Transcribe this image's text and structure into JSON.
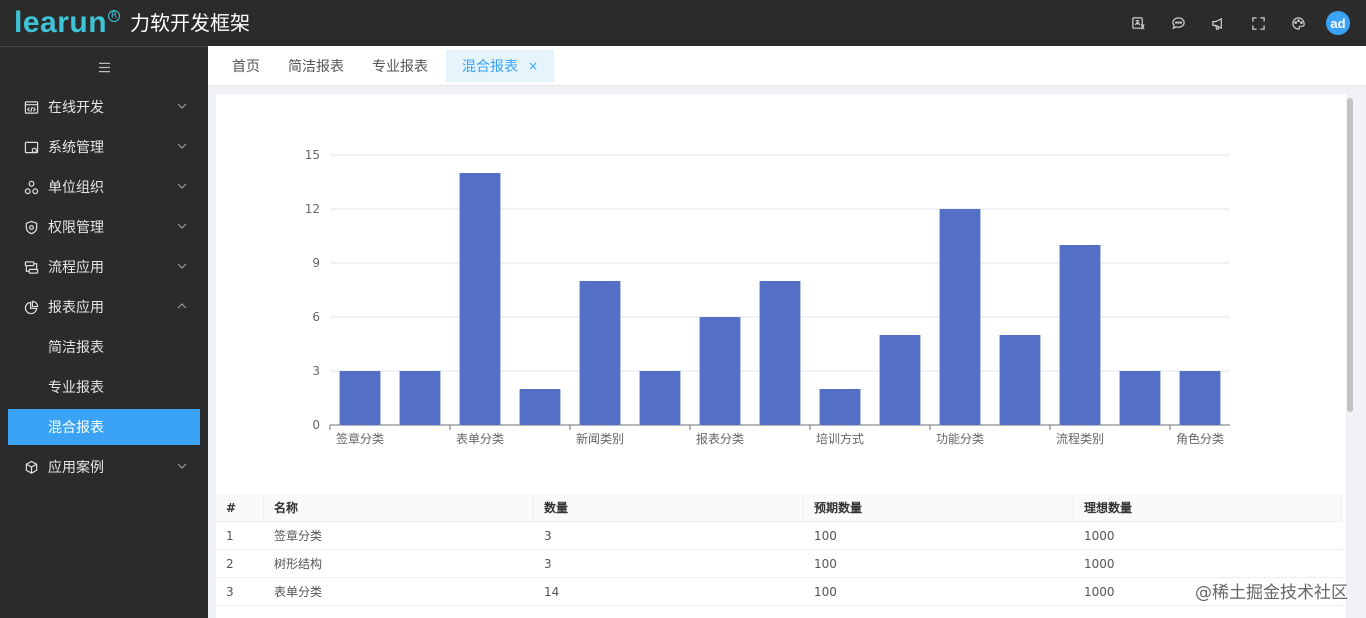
{
  "brand": {
    "logo_word": "learun",
    "logo_mark": "R",
    "title": "力软开发框架"
  },
  "header": {
    "icons": [
      "translate-icon",
      "message-icon",
      "notification-icon",
      "fullscreen-icon",
      "palette-icon"
    ],
    "avatar_text": "ad"
  },
  "sidebar": {
    "items": [
      {
        "label": "在线开发",
        "icon": "code-window-icon",
        "expanded": false
      },
      {
        "label": "系统管理",
        "icon": "system-icon",
        "expanded": false
      },
      {
        "label": "单位组织",
        "icon": "organization-icon",
        "expanded": false
      },
      {
        "label": "权限管理",
        "icon": "shield-icon",
        "expanded": false
      },
      {
        "label": "流程应用",
        "icon": "flow-icon",
        "expanded": false
      },
      {
        "label": "报表应用",
        "icon": "pie-chart-icon",
        "expanded": true
      },
      {
        "label": "应用案例",
        "icon": "cube-icon",
        "expanded": false
      }
    ],
    "sub_items": [
      {
        "label": "简洁报表",
        "active": false
      },
      {
        "label": "专业报表",
        "active": false
      },
      {
        "label": "混合报表",
        "active": true
      }
    ]
  },
  "tabs": [
    {
      "label": "首页",
      "active": false
    },
    {
      "label": "简洁报表",
      "active": false
    },
    {
      "label": "专业报表",
      "active": false
    },
    {
      "label": "混合报表",
      "active": true,
      "close": "×"
    }
  ],
  "colors": {
    "accent": "#3aa3f6",
    "bar": "#5470c6",
    "dark_bg": "#2b2b2b",
    "logo": "#3ec4d6"
  },
  "chart_data": {
    "type": "bar",
    "categories": [
      "签章分类",
      "树形结构",
      "表单分类",
      "",
      "新闻类别",
      "",
      "报表分类",
      "",
      "培训方式",
      "",
      "功能分类",
      "",
      "流程类别",
      "",
      "角色分类"
    ],
    "tick_labels": [
      "签章分类",
      "表单分类",
      "新闻类别",
      "报表分类",
      "培训方式",
      "功能分类",
      "流程类别",
      "角色分类"
    ],
    "values": [
      3,
      3,
      14,
      2,
      8,
      3,
      6,
      8,
      2,
      5,
      12,
      5,
      10,
      3,
      3
    ],
    "y_ticks": [
      "0",
      "3",
      "6",
      "9",
      "12",
      "15"
    ],
    "ylim": [
      0,
      15
    ],
    "grid": true
  },
  "table": {
    "headers": [
      "#",
      "名称",
      "数量",
      "预期数量",
      "理想数量"
    ],
    "rows": [
      [
        "1",
        "签章分类",
        "3",
        "100",
        "1000"
      ],
      [
        "2",
        "树形结构",
        "3",
        "100",
        "1000"
      ],
      [
        "3",
        "表单分类",
        "14",
        "100",
        "1000"
      ]
    ]
  },
  "watermark": "@稀土掘金技术社区"
}
